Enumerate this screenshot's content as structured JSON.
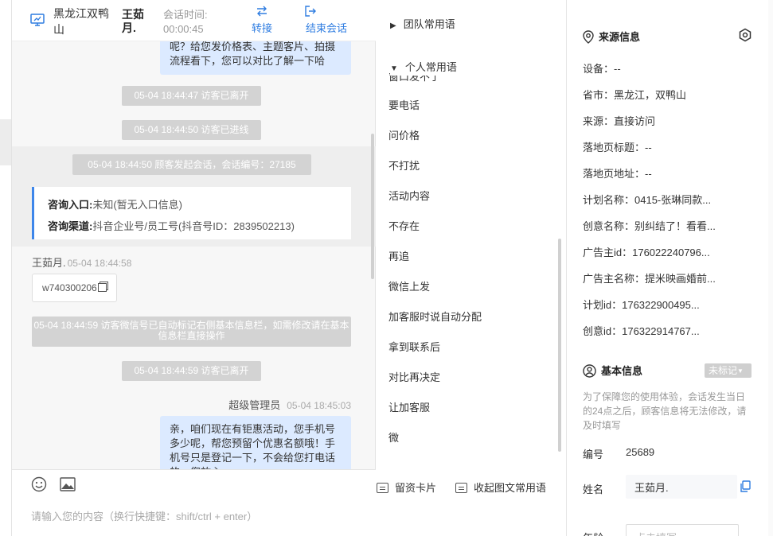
{
  "header": {
    "location": "黑龙江双鸭山",
    "visitor_name": "王茹月.",
    "session_time_label": "会话时间:",
    "session_time_value": "00:00:45",
    "transfer_label": "转接",
    "end_chat_label": "结束会话"
  },
  "chat": {
    "top_bubble": "呢？给您发价格表、主题客片、拍摄流程看下，您可以对比了解一下哈",
    "sys_left1": "05-04 18:44:47 访客已离开",
    "sys_enter": "05-04 18:44:50 访客已进线",
    "sys_session": "05-04 18:44:50 顾客发起会话，会话编号：27185",
    "entry_label": "咨询入口:",
    "entry_value": "未知(暂无入口信息)",
    "channel_label": "咨询渠道:",
    "channel_value": "抖音企业号/员工号(抖音号ID：2839502213)",
    "visitor_name": "王茹月.",
    "visitor_time": "05-04 18:44:58",
    "visitor_msg": "w740300206",
    "sys_wechat": "05-04 18:44:59 访客微信号已自动标记右侧基本信息栏，如需修改请在基本信息栏直接操作",
    "sys_left2": "05-04 18:44:59 访客已离开",
    "admin_name": "超级管理员",
    "admin_time": "05-04 18:45:03",
    "bottom_bubble": "亲，咱们现在有钜惠活动，您手机号多少呢，帮您预留个优惠名额哦！手机号只是登记一下，不会给您打电话的，您放心"
  },
  "input": {
    "placeholder": "请输入您的内容（换行快捷键：shift/ctrl + enter）"
  },
  "phrases": {
    "team_group": "团队常用语",
    "personal_group": "个人常用语",
    "partial_item": "窗口发不了",
    "items": [
      "要电话",
      "问价格",
      "不打扰",
      "活动内容",
      "不存在",
      "再追",
      "微信上发",
      "加客服时说自动分配",
      "拿到联系后",
      "对比再决定",
      "让加客服",
      "微"
    ],
    "lead_card": "留资卡片",
    "collapse": "收起图文常用语"
  },
  "source": {
    "title": "来源信息",
    "rows": [
      "设备：--",
      "省市：黑龙江，双鸭山",
      "来源：直接访问",
      "落地页标题：--",
      "落地页地址：--",
      "计划名称：0415-张琳同款...",
      "创意名称：别纠结了！看看...",
      "广告主id：176022240796...",
      "广告主名称：提米映画婚前...",
      "计划id：176322900495...",
      "创意id：176322914767..."
    ]
  },
  "basic": {
    "title": "基本信息",
    "tag": "未标记",
    "note": "为了保障您的使用体验，会话发生当日的24点之后，顾客信息将无法修改，请及时填写",
    "id_label": "编号",
    "id_value": "25689",
    "name_label": "姓名",
    "name_value": "王茹月.",
    "age_label": "年龄",
    "age_placeholder": "点击填写"
  },
  "colors": {
    "accent": "#2f7de1",
    "bubble_self": "#dceaff",
    "system_msg": "#d3d3d3"
  }
}
